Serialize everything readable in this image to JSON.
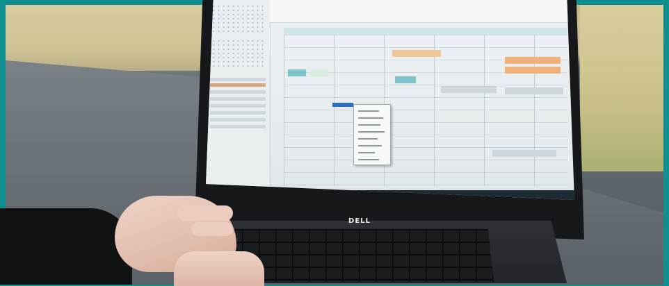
{
  "photo": {
    "subject": "laptop-calendar-photo",
    "laptop_logo": "DELL",
    "frame_color": "#0f8f8f"
  }
}
